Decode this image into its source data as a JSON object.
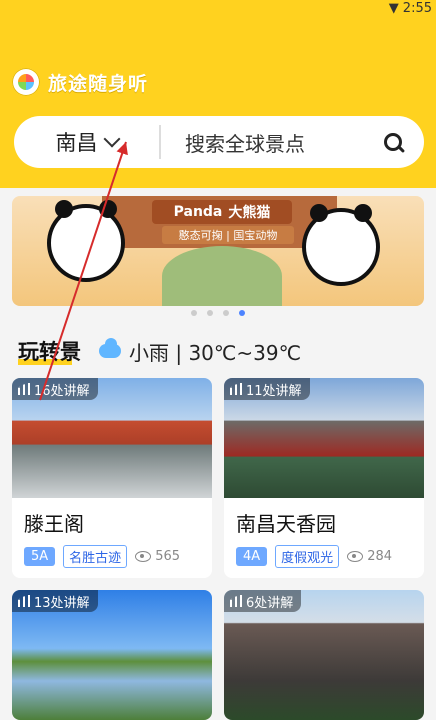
{
  "status": {
    "time": "2:55"
  },
  "app": {
    "name": "旅途随身听"
  },
  "search": {
    "city": "南昌",
    "placeholder": "搜索全球景点"
  },
  "banner": {
    "word_en": "Panda",
    "word_cn": "大熊猫",
    "subtitle": "憨态可掬 | 国宝动物"
  },
  "section": {
    "title": "玩转景",
    "weather": "小雨 | 30℃~39℃"
  },
  "cards": [
    {
      "badge": "16处讲解",
      "name": "滕王阁",
      "grade": "5A",
      "type": "名胜古迹",
      "views": "565"
    },
    {
      "badge": "11处讲解",
      "name": "南昌天香园",
      "grade": "4A",
      "type": "度假观光",
      "views": "284"
    },
    {
      "badge": "13处讲解"
    },
    {
      "badge": "6处讲解"
    }
  ],
  "colors": {
    "brand_yellow": "#ffd21f",
    "tag_blue": "#6ea8ff"
  }
}
